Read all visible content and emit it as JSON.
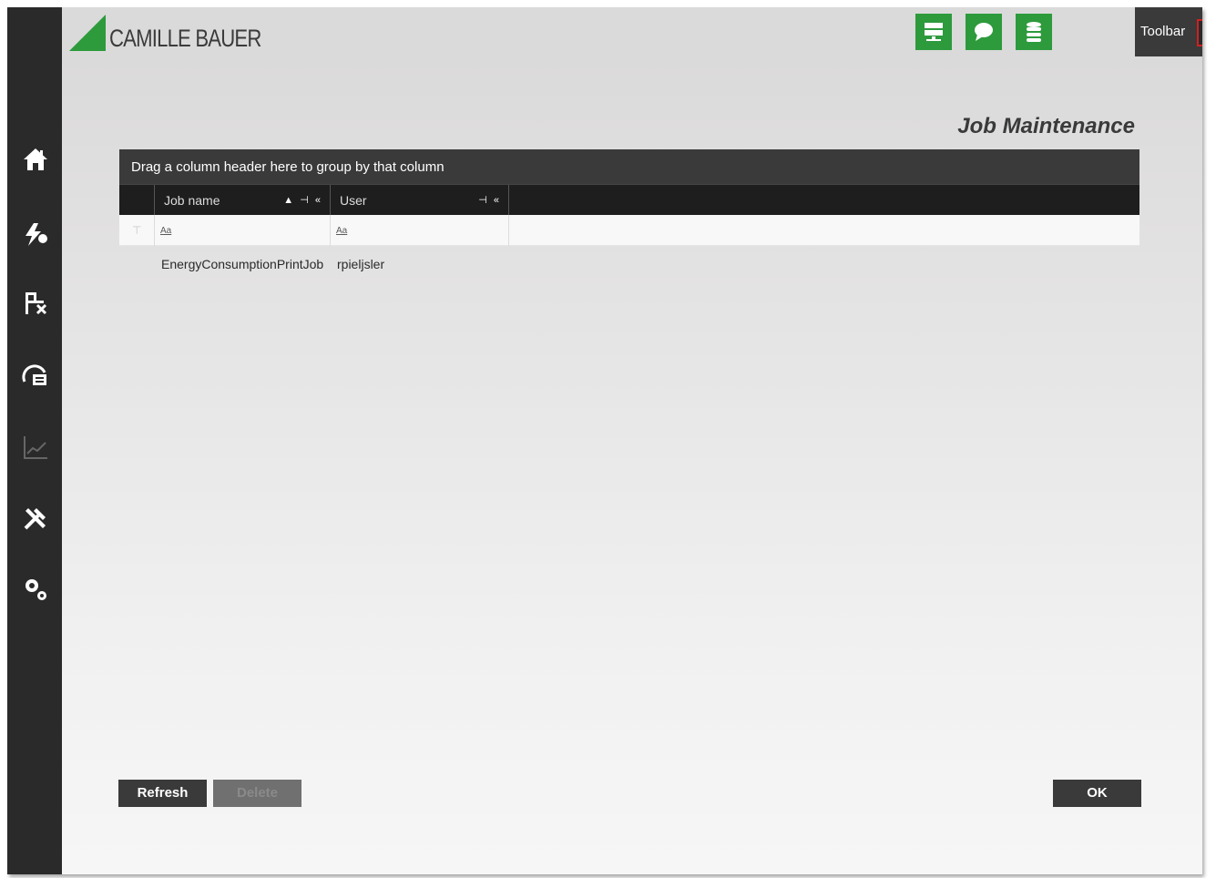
{
  "header": {
    "logo_text": "CAMILLE BAUER",
    "toolbar_label": "Toolbar",
    "toggle_state": "off"
  },
  "header_buttons": [
    {
      "icon": "server-icon"
    },
    {
      "icon": "chat-icon"
    },
    {
      "icon": "database-icon"
    }
  ],
  "sidebar": {
    "items": [
      {
        "icon": "home-icon"
      },
      {
        "icon": "flash-icon"
      },
      {
        "icon": "topology-icon"
      },
      {
        "icon": "dashboard-icon"
      },
      {
        "icon": "chart-icon",
        "disabled": true
      },
      {
        "icon": "tools-icon"
      },
      {
        "icon": "settings-icon"
      }
    ]
  },
  "page": {
    "title": "Job Maintenance"
  },
  "grid": {
    "group_hint": "Drag a column header here to group by that column",
    "columns": [
      {
        "label": "Job name",
        "filter_placeholder": "Aa"
      },
      {
        "label": "User",
        "filter_placeholder": "Aa"
      }
    ],
    "rows": [
      {
        "job_name": "EnergyConsumptionPrintJob",
        "user": "rpieljsler"
      }
    ]
  },
  "buttons": {
    "refresh": "Refresh",
    "delete": "Delete",
    "ok": "OK"
  },
  "colors": {
    "accent_green": "#2d9a3c",
    "toggle_red": "#d42a2a",
    "sidebar_bg": "#2a2a2a"
  }
}
